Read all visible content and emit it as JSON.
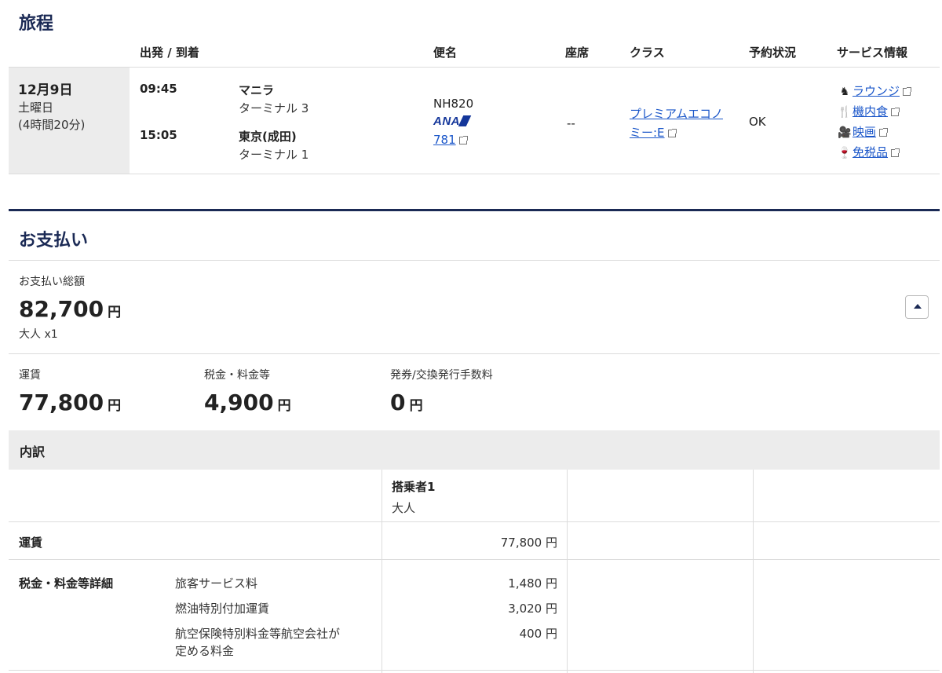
{
  "itinerary": {
    "title": "旅程",
    "columns": {
      "departure_arrival": "出発 / 到着",
      "flight": "便名",
      "seat": "座席",
      "class": "クラス",
      "status": "予約状況",
      "services": "サービス情報"
    },
    "segment": {
      "date": "12月9日",
      "weekday": "土曜日",
      "duration": "(4時間20分)",
      "depart_time": "09:45",
      "depart_city": "マニラ",
      "depart_terminal": "ターミナル 3",
      "arrive_time": "15:05",
      "arrive_city": "東京(成田)",
      "arrive_terminal": "ターミナル 1",
      "flight_number": "NH820",
      "airline_logo": "ANA",
      "aircraft": "781",
      "seat": "--",
      "class_line1": "プレミアムエコノ",
      "class_line2": "ミー:E",
      "status": "OK",
      "services": [
        {
          "icon": "lounge-icon",
          "label": "ラウンジ"
        },
        {
          "icon": "meal-icon",
          "label": "機内食"
        },
        {
          "icon": "movie-icon",
          "label": "映画"
        },
        {
          "icon": "duty-free-icon",
          "label": "免税品"
        }
      ]
    }
  },
  "payment": {
    "title": "お支払い",
    "total_label": "お支払い総額",
    "total_amount": "82,700",
    "currency": "円",
    "passengers": "大人 x1",
    "fare_label": "運賃",
    "fare_amount": "77,800",
    "tax_label": "税金・料金等",
    "tax_amount": "4,900",
    "fee_label": "発券/交換発行手数料",
    "fee_amount": "0"
  },
  "breakdown": {
    "title": "内訳",
    "passenger_header": "搭乗者1",
    "passenger_type": "大人",
    "fare_row_label": "運賃",
    "fare_row_amount": "77,800 円",
    "tax_row_label": "税金・料金等詳細",
    "tax_items": [
      {
        "name": "旅客サービス料",
        "amount": "1,480 円"
      },
      {
        "name": "燃油特別付加運賃",
        "amount": "3,020 円"
      },
      {
        "name_line1": "航空保険特別料金等航空会社が",
        "name_line2": "定める料金",
        "amount": "400 円"
      }
    ]
  }
}
